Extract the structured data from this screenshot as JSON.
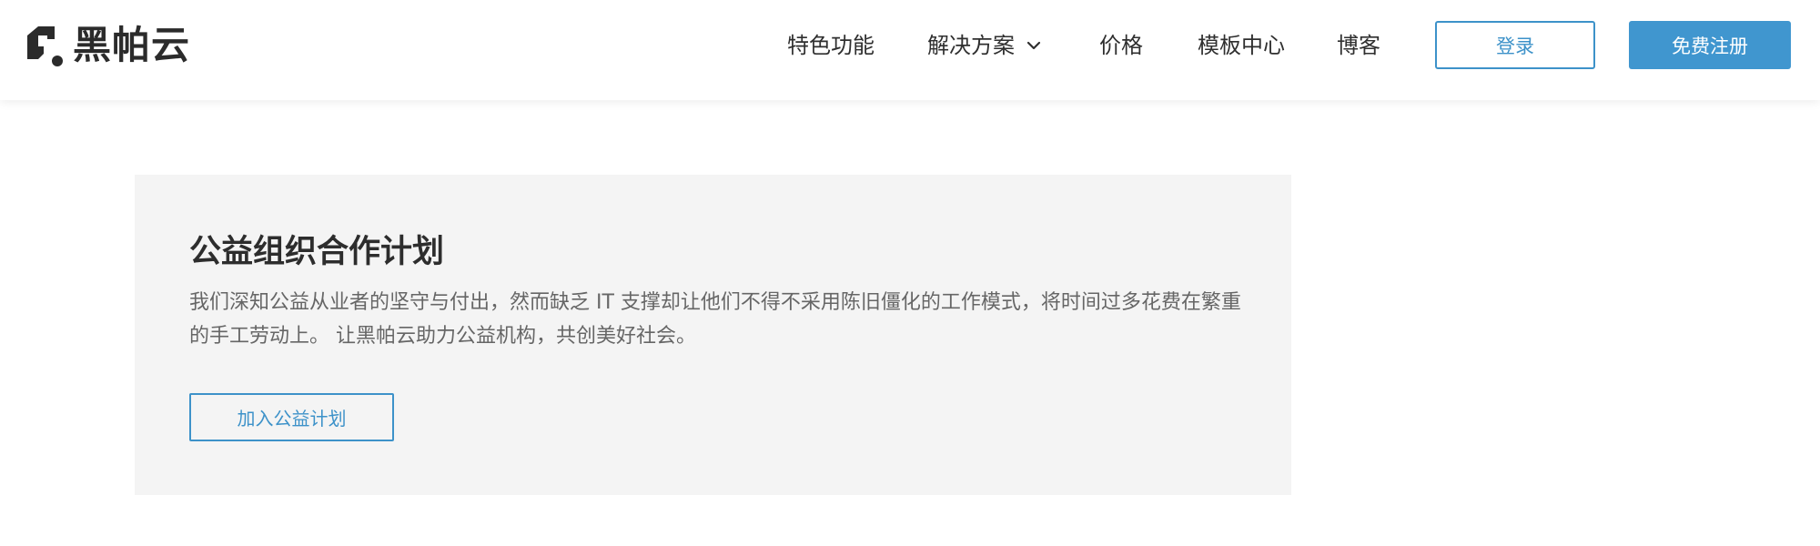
{
  "brand": {
    "name": "黑帕云",
    "logo_icon": "heipayun-logo-mark",
    "color": "#2b2b2b"
  },
  "nav": {
    "items": [
      {
        "label": "特色功能"
      },
      {
        "label": "解决方案",
        "icon": "chevron-down-icon"
      },
      {
        "label": "价格"
      },
      {
        "label": "模板中心"
      },
      {
        "label": "博客"
      }
    ],
    "login_label": "登录",
    "register_label": "免费注册"
  },
  "card": {
    "title": "公益组织合作计划",
    "description": "我们深知公益从业者的坚守与付出，然而缺乏 IT 支撑却让他们不得不采用陈旧僵化的工作模式，将时间过多花费在繁重的手工劳动上。 让黑帕云助力公益机构，共创美好社会。",
    "button_label": "加入公益计划"
  },
  "colors": {
    "accent": "#3d92c9",
    "primary_button": "#4096cf",
    "card_background": "#f4f4f4",
    "text_dark": "#2f2f2f",
    "text_muted": "#666666"
  }
}
